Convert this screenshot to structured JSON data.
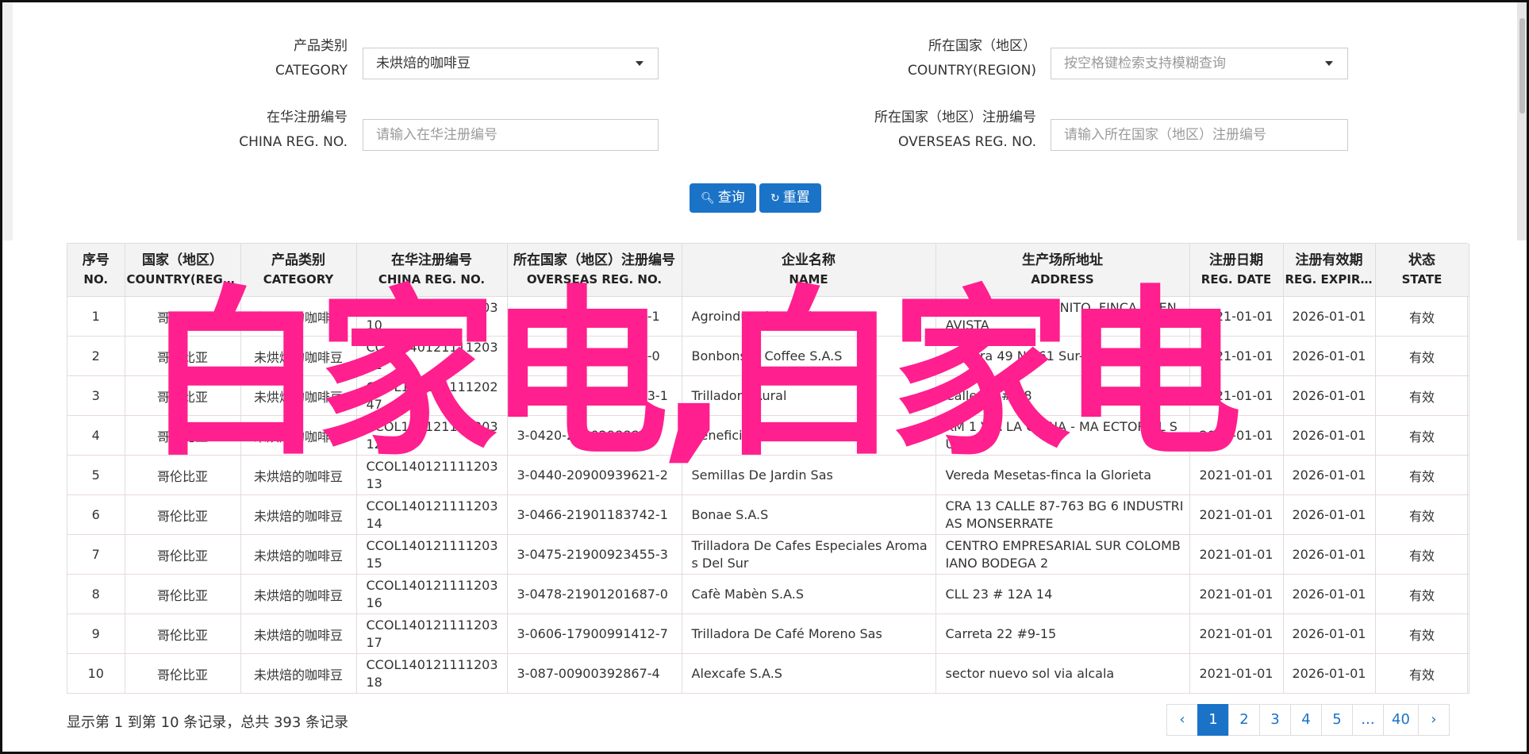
{
  "search": {
    "category": {
      "label_zh": "产品类别",
      "label_en": "CATEGORY",
      "value": "未烘焙的咖啡豆"
    },
    "country": {
      "label_zh": "所在国家（地区）",
      "label_en": "COUNTRY(REGION)",
      "placeholder": "按空格键检索支持模糊查询"
    },
    "china_reg": {
      "label_zh": "在华注册编号",
      "label_en": "CHINA REG. NO.",
      "placeholder": "请输入在华注册编号"
    },
    "overseas_reg": {
      "label_zh": "所在国家（地区）注册编号",
      "label_en": "OVERSEAS REG. NO.",
      "placeholder": "请输入所在国家（地区）注册编号"
    },
    "query_label": "查询",
    "reset_label": "重置"
  },
  "table": {
    "headers": [
      {
        "zh": "序号",
        "en": "NO."
      },
      {
        "zh": "国家（地区）",
        "en": "COUNTRY(REGIO..."
      },
      {
        "zh": "产品类别",
        "en": "CATEGORY"
      },
      {
        "zh": "在华注册编号",
        "en": "CHINA REG. NO."
      },
      {
        "zh": "所在国家（地区）注册编号",
        "en": "OVERSEAS REG. NO."
      },
      {
        "zh": "企业名称",
        "en": "NAME"
      },
      {
        "zh": "生产场所地址",
        "en": "ADDRESS"
      },
      {
        "zh": "注册日期",
        "en": "REG. DATE"
      },
      {
        "zh": "注册有效期",
        "en": "REG. EXPIRE ..."
      },
      {
        "zh": "状态",
        "en": "STATE"
      }
    ],
    "rows": [
      {
        "no": "1",
        "country": "哥伦比亚",
        "category": "未烘焙的咖啡豆",
        "china_reg": "CCOL140121111203 10",
        "overseas_reg": "3-0390-9900486851-1",
        "name": "Agroindustrias Gallego S.A.S.",
        "address": "VEREDA PATIO BONITO, FINCA BUEN AVISTA",
        "reg_date": "2021-01-01",
        "expire": "2026-01-01",
        "state": "有效"
      },
      {
        "no": "2",
        "country": "哥伦比亚",
        "category": "未烘焙的咖啡豆",
        "china_reg": "CCOL140121111203 11",
        "overseas_reg": "3-0402-9900486851-0",
        "name": "Bonbons & Coffee S.A.S",
        "address": "Carrera 49 No 61 Sur-540 Bodega 5",
        "reg_date": "2021-01-01",
        "expire": "2026-01-01",
        "state": "有效"
      },
      {
        "no": "3",
        "country": "哥伦比亚",
        "category": "未烘焙的咖啡豆",
        "china_reg": "CCOL140121111202 47",
        "overseas_reg": "3-0417-21900921403-1",
        "name": "Trilladora Rural",
        "address": "Calle 16 # 28",
        "reg_date": "2021-01-01",
        "expire": "2026-01-01",
        "state": "有效"
      },
      {
        "no": "4",
        "country": "哥伦比亚",
        "category": "未烘焙的咖啡豆",
        "china_reg": "CCOL140121111203 12",
        "overseas_reg": "3-0420-21902988839",
        "name": "Beneficiadero La Insula",
        "address": "KM 1 VIA LA CHINA - MA ECTOR EL SUE",
        "reg_date": "2021-01-01",
        "expire": "2026-01-01",
        "state": "有效"
      },
      {
        "no": "5",
        "country": "哥伦比亚",
        "category": "未烘焙的咖啡豆",
        "china_reg": "CCOL140121111203 13",
        "overseas_reg": "3-0440-20900939621-2",
        "name": "Semillas De Jardin Sas",
        "address": "Vereda Mesetas-finca la Glorieta",
        "reg_date": "2021-01-01",
        "expire": "2026-01-01",
        "state": "有效"
      },
      {
        "no": "6",
        "country": "哥伦比亚",
        "category": "未烘焙的咖啡豆",
        "china_reg": "CCOL140121111203 14",
        "overseas_reg": "3-0466-21901183742-1",
        "name": "Bonae S.A.S",
        "address": "CRA 13 CALLE 87-763 BG 6 INDUSTRI AS MONSERRATE",
        "reg_date": "2021-01-01",
        "expire": "2026-01-01",
        "state": "有效"
      },
      {
        "no": "7",
        "country": "哥伦比亚",
        "category": "未烘焙的咖啡豆",
        "china_reg": "CCOL140121111203 15",
        "overseas_reg": "3-0475-21900923455-3",
        "name": "Trilladora De Cafes Especiales Aromas Del Sur",
        "address": "CENTRO EMPRESARIAL SUR COLOMB IANO BODEGA 2",
        "reg_date": "2021-01-01",
        "expire": "2026-01-01",
        "state": "有效"
      },
      {
        "no": "8",
        "country": "哥伦比亚",
        "category": "未烘焙的咖啡豆",
        "china_reg": "CCOL140121111203 16",
        "overseas_reg": "3-0478-21901201687-0",
        "name": "Cafè Mabèn S.A.S",
        "address": "CLL 23 # 12A 14",
        "reg_date": "2021-01-01",
        "expire": "2026-01-01",
        "state": "有效"
      },
      {
        "no": "9",
        "country": "哥伦比亚",
        "category": "未烘焙的咖啡豆",
        "china_reg": "CCOL140121111203 17",
        "overseas_reg": "3-0606-17900991412-7",
        "name": "Trilladora De Café Moreno Sas",
        "address": "Carreta 22 #9-15",
        "reg_date": "2021-01-01",
        "expire": "2026-01-01",
        "state": "有效"
      },
      {
        "no": "10",
        "country": "哥伦比亚",
        "category": "未烘焙的咖啡豆",
        "china_reg": "CCOL140121111203 18",
        "overseas_reg": "3-087-00900392867-4",
        "name": "Alexcafe S.A.S",
        "address": "sector nuevo sol via alcala",
        "reg_date": "2021-01-01",
        "expire": "2026-01-01",
        "state": "有效"
      }
    ]
  },
  "footer": {
    "summary": "显示第 1 到第 10 条记录，总共 393 条记录",
    "pages": [
      "‹",
      "1",
      "2",
      "3",
      "4",
      "5",
      "...",
      "40",
      "›"
    ],
    "active_page": "1"
  },
  "watermark": "白家电,白家电",
  "colors": {
    "primary": "#1a73c7",
    "watermark": "#ff1f8e"
  }
}
